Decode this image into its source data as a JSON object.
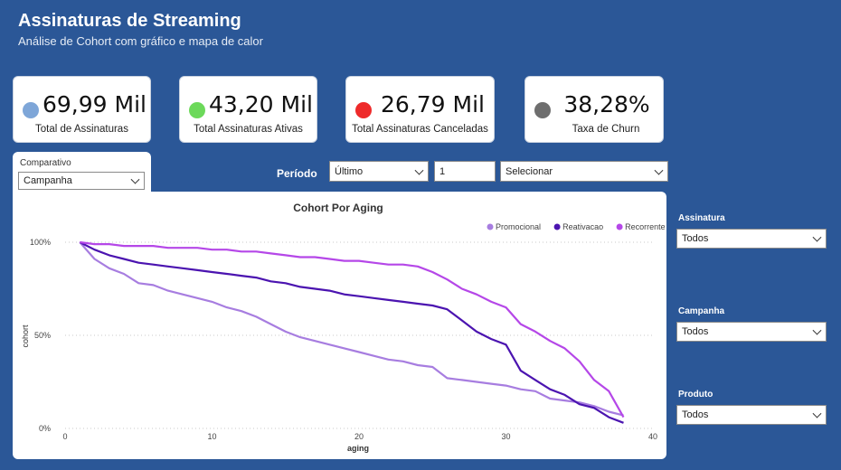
{
  "header": {
    "title": "Assinaturas de Streaming",
    "subtitle": "Análise de Cohort com gráfico e mapa de calor"
  },
  "kpis": [
    {
      "value": "69,99 Mil",
      "label": "Total de Assinaturas",
      "color": "#7ea6d8"
    },
    {
      "value": "43,20 Mil",
      "label": "Total Assinaturas Ativas",
      "color": "#6cd95a"
    },
    {
      "value": "26,79 Mil",
      "label": "Total Assinaturas Canceladas",
      "color": "#ee2a2a"
    },
    {
      "value": "38,28%",
      "label": "Taxa de Churn",
      "color": "#6e6e6e"
    }
  ],
  "comparativo": {
    "label": "Comparativo",
    "value": "Campanha"
  },
  "periodo": {
    "label": "Período",
    "mode": "Último",
    "count": "1",
    "unit": "Selecionar"
  },
  "filters": [
    {
      "label": "Assinatura",
      "value": "Todos"
    },
    {
      "label": "Campanha",
      "value": "Todos"
    },
    {
      "label": "Produto",
      "value": "Todos"
    }
  ],
  "chart_data": {
    "type": "line",
    "title": "Cohort Por Aging",
    "xlabel": "aging",
    "ylabel": "cohort",
    "xlim": [
      0,
      40
    ],
    "ylim": [
      0,
      100
    ],
    "x_ticks": [
      "0",
      "10",
      "20",
      "30",
      "40"
    ],
    "y_ticks": [
      "0%",
      "50%",
      "100%"
    ],
    "legend_position": "top-right",
    "grid": "horizontal-dotted",
    "series": [
      {
        "name": "Promocional",
        "color": "#a77de0",
        "x": [
          1,
          2,
          3,
          4,
          5,
          6,
          7,
          8,
          9,
          10,
          11,
          12,
          13,
          14,
          15,
          16,
          17,
          18,
          19,
          20,
          21,
          22,
          23,
          24,
          25,
          26,
          27,
          28,
          29,
          30,
          31,
          32,
          33,
          34,
          35,
          36,
          37,
          38
        ],
        "values": [
          100,
          91,
          86,
          83,
          78,
          77,
          74,
          72,
          70,
          68,
          65,
          63,
          60,
          56,
          52,
          49,
          47,
          45,
          43,
          41,
          39,
          37,
          36,
          34,
          33,
          27,
          26,
          25,
          24,
          23,
          21,
          20,
          16,
          15,
          14,
          12,
          9,
          7
        ]
      },
      {
        "name": "Reativacao",
        "color": "#4b14b0",
        "x": [
          1,
          2,
          3,
          4,
          5,
          6,
          7,
          8,
          9,
          10,
          11,
          12,
          13,
          14,
          15,
          16,
          17,
          18,
          19,
          20,
          21,
          22,
          23,
          24,
          25,
          26,
          27,
          28,
          29,
          30,
          31,
          32,
          33,
          34,
          35,
          36,
          37,
          38
        ],
        "values": [
          100,
          96,
          93,
          91,
          89,
          88,
          87,
          86,
          85,
          84,
          83,
          82,
          81,
          79,
          78,
          76,
          75,
          74,
          72,
          71,
          70,
          69,
          68,
          67,
          66,
          64,
          58,
          52,
          48,
          45,
          31,
          26,
          21,
          18,
          13,
          11,
          6,
          3
        ]
      },
      {
        "name": "Recorrente",
        "color": "#b547e8",
        "x": [
          1,
          2,
          3,
          4,
          5,
          6,
          7,
          8,
          9,
          10,
          11,
          12,
          13,
          14,
          15,
          16,
          17,
          18,
          19,
          20,
          21,
          22,
          23,
          24,
          25,
          26,
          27,
          28,
          29,
          30,
          31,
          32,
          33,
          34,
          35,
          36,
          37,
          38
        ],
        "values": [
          100,
          99,
          99,
          98,
          98,
          98,
          97,
          97,
          97,
          96,
          96,
          95,
          95,
          94,
          93,
          92,
          92,
          91,
          90,
          90,
          89,
          88,
          88,
          87,
          84,
          80,
          75,
          72,
          68,
          65,
          56,
          52,
          47,
          43,
          36,
          26,
          20,
          6
        ]
      }
    ]
  }
}
